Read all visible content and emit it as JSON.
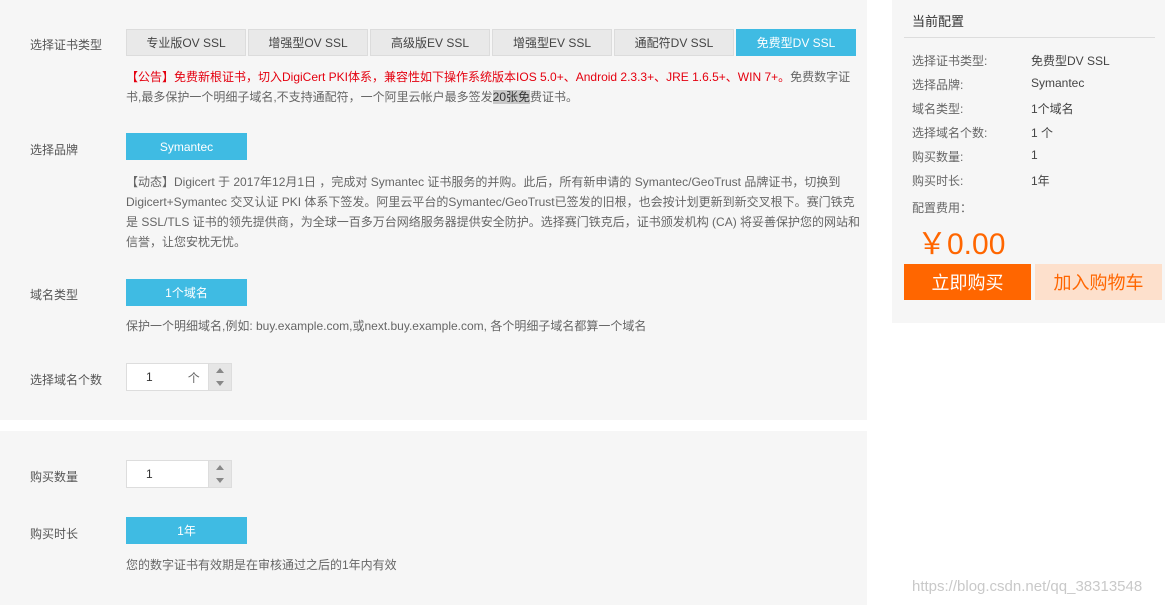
{
  "cert_type": {
    "label": "选择证书类型",
    "tabs": [
      "专业版OV SSL",
      "增强型OV SSL",
      "高级版EV SSL",
      "增强型EV SSL",
      "通配符DV SSL",
      "免费型DV SSL"
    ],
    "active_index": 5,
    "notice_red": "【公告】免费新根证书，切入DigiCert PKI体系，兼容性如下操作系统版本IOS 5.0+、Android 2.3.3+、JRE 1.6.5+、WIN 7+。",
    "notice_text1": "免费数字证书,最多保护一个明细子域名,不支持通配符，一个阿里云帐户最多签发",
    "notice_highlight": "20张免",
    "notice_text2": "费证书。"
  },
  "brand": {
    "label": "选择品牌",
    "button": "Symantec",
    "desc": "【动态】Digicert 于 2017年12月1日 ，完成对 Symantec 证书服务的并购。此后，所有新申请的 Symantec/GeoTrust 品牌证书，切换到 Digicert+Symantec 交叉认证 PKI 体系下签发。阿里云平台的Symantec/GeoTrust已签发的旧根，也会按计划更新到新交叉根下。赛门铁克是 SSL/TLS 证书的领先提供商，为全球一百多万台网络服务器提供安全防护。选择赛门铁克后，证书颁发机构 (CA) 将妥善保护您的网站和信誉，让您安枕无忧。"
  },
  "domain_type": {
    "label": "域名类型",
    "button": "1个域名",
    "desc": "保护一个明细域名,例如: buy.example.com,或next.buy.example.com, 各个明细子域名都算一个域名"
  },
  "domain_count": {
    "label": "选择域名个数",
    "value": "1",
    "unit": "个"
  },
  "quantity": {
    "label": "购买数量",
    "value": "1"
  },
  "duration": {
    "label": "购买时长",
    "button": "1年",
    "desc": "您的数字证书有效期是在审核通过之后的1年内有效"
  },
  "sidebar": {
    "title": "当前配置",
    "rows": [
      {
        "key": "选择证书类型:",
        "value": "免费型DV SSL"
      },
      {
        "key": "选择品牌:",
        "value": "Symantec"
      },
      {
        "key": "域名类型:",
        "value": "1个域名"
      },
      {
        "key": "选择域名个数:",
        "value": "1 个"
      },
      {
        "key": "购买数量:",
        "value": "1"
      },
      {
        "key": "购买时长:",
        "value": "1年"
      }
    ],
    "fee_label": "配置费用：",
    "price": "￥0.00",
    "buy_button": "立即购买",
    "cart_button": "加入购物车"
  },
  "watermark": "https://blog.csdn.net/qq_38313548",
  "colors": {
    "accent_blue": "#3fbbe3",
    "accent_orange": "#ff6600",
    "notice_red": "#e4000f"
  }
}
